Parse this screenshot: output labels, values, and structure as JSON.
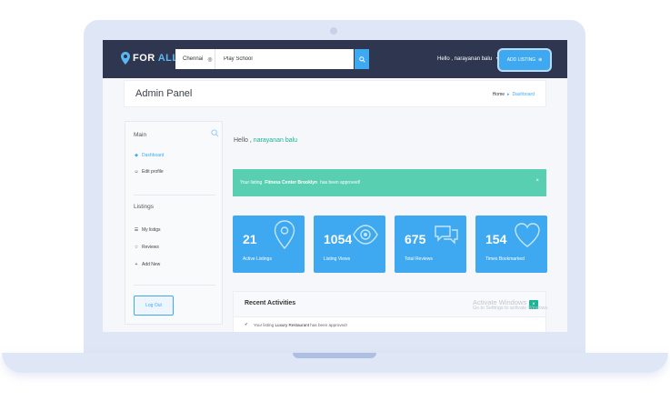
{
  "header": {
    "logo_part1": "FOR",
    "logo_part2": "ALLIN",
    "search_city": "Chennai",
    "search_value": "Play School",
    "user_menu_label": "Hello , narayanan balu",
    "add_listing_label": "ADD LISTING"
  },
  "titlebar": {
    "title": "Admin Panel",
    "breadcrumb": [
      "Home",
      "Dashboard"
    ]
  },
  "sidebar": {
    "main_title": "Main",
    "main_items": [
      {
        "label": "Dashboard",
        "icon": "dashboard-icon",
        "active": true
      },
      {
        "label": "Edit profile",
        "icon": "user-icon",
        "active": false
      }
    ],
    "listings_title": "Listings",
    "listing_items": [
      {
        "label": "My listigs",
        "icon": "list-icon"
      },
      {
        "label": "Reviews",
        "icon": "star-icon"
      },
      {
        "label": "Add New",
        "icon": "plus-icon"
      }
    ],
    "logout_label": "Log Out"
  },
  "main": {
    "greeting_prefix": "Hello ,",
    "greeting_name": "narayanan balu",
    "alert": {
      "prefix": "Your listing",
      "listing_name": "Fitness Center Brooklyn",
      "suffix": "has been approved!",
      "close": "×"
    },
    "stats": [
      {
        "value": "21",
        "label": "Active Listings",
        "icon": "map-pin-icon"
      },
      {
        "value": "1054",
        "label": "Listing Views",
        "icon": "eye-icon"
      },
      {
        "value": "675",
        "label": "Total Reviews",
        "icon": "chat-bubbles-icon"
      },
      {
        "value": "154",
        "label": "Times Bookmarked",
        "icon": "heart-icon"
      }
    ],
    "activities": {
      "title": "Recent Activities",
      "close": "×",
      "items": [
        {
          "prefix": "Your listing",
          "listing": "Luxury Restaurant",
          "suffix": "has been approved!"
        }
      ]
    }
  },
  "watermark": {
    "line1": "Activate Windows",
    "line2": "Go to Settings to activate Windows."
  },
  "colors": {
    "header_bg": "#2f3650",
    "accent_blue": "#3ea9f1",
    "alert_green": "#58cfb1",
    "name_green": "#1ab394"
  }
}
